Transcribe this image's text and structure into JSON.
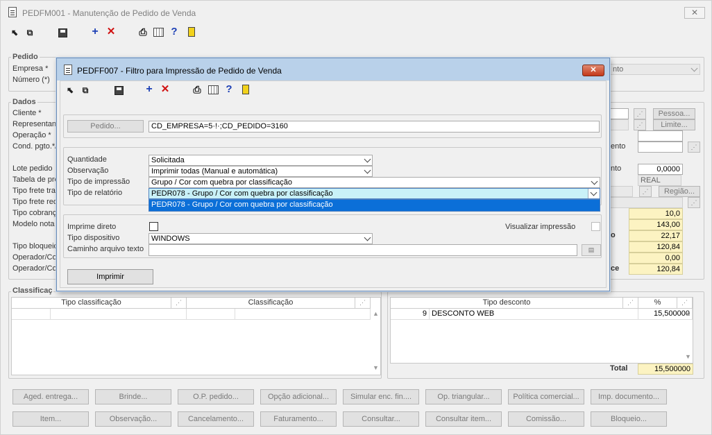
{
  "main": {
    "title": "PEDFM001 - Manutenção de Pedido de Venda",
    "close_glyph": "✕",
    "toolbar": [
      "cursor-icon",
      "copy-icon",
      "save-icon",
      "add-icon",
      "delete-icon",
      "print-icon",
      "calculator-icon",
      "help-icon",
      "exit-icon"
    ],
    "pedido_group": {
      "title": "Pedido",
      "empresa_label": "Empresa *",
      "numero_label": "Número (*)",
      "partial_combo_value": "nto"
    },
    "dados_group": {
      "title": "Dados",
      "labels": [
        "Cliente *",
        "Representan",
        "Operação *",
        "Cond. pgto.*/",
        "Lote pedido",
        "Tabela de pre",
        "Tipo frete tra",
        "Tipo frete red",
        "Tipo cobranç",
        "Modelo nota",
        "Tipo bloqueio",
        "Operador/Co",
        "Operador/Co"
      ],
      "pessoa_button": "Pessoa...",
      "limite_button": "Limite...",
      "regiao_button": "Região...",
      "right_label_1": "ento",
      "right_label_2": "nto",
      "right_label_3": "o",
      "right_label_4": "ce",
      "value_0000": "0,0000",
      "real_value": "REAL",
      "values": [
        "10,0",
        "143,00",
        "22,17",
        "120,84",
        "0,00",
        "120,84"
      ]
    },
    "classificacao": {
      "title": "Classificaç",
      "columns": [
        "Tipo classificação",
        "Classificação"
      ]
    },
    "desconto": {
      "columns": [
        "Tipo desconto",
        "%"
      ],
      "rows": [
        {
          "code": "9",
          "desc": "DESCONTO WEB",
          "pct": "15,500000"
        }
      ],
      "total_label": "Total",
      "total_value": "15,500000"
    },
    "buttons_row1": [
      "Aged. entrega...",
      "Brinde...",
      "O.P. pedido...",
      "Opção adicional...",
      "Simular enc. fin....",
      "Op. triangular...",
      "Política comercial...",
      "Imp. documento..."
    ],
    "buttons_row2": [
      "Item...",
      "Observação...",
      "Cancelamento...",
      "Faturamento...",
      "Consultar...",
      "Consultar item...",
      "Comissão...",
      "Bloqueio..."
    ]
  },
  "dialog": {
    "title": "PEDFF007 - Filtro para Impressão de Pedido de Venda",
    "close_glyph": "✕",
    "pedido_button": "Pedido...",
    "pedido_value": "CD_EMPRESA=5·!·;CD_PEDIDO=3160",
    "quantidade_label": "Quantidade",
    "quantidade_value": "Solicitada",
    "observacao_label": "Observação",
    "observacao_value": "Imprimir todas (Manual e automática)",
    "tipo_impressao_label": "Tipo de impressão",
    "tipo_impressao_value": "Grupo / Cor com quebra por classificação",
    "tipo_relatorio_label": "Tipo de relatório",
    "tipo_relatorio_value": "PEDR078 - Grupo / Cor com quebra por classificação",
    "dropdown_options": [
      "PEDR078 - Grupo / Cor com quebra por classificação"
    ],
    "imprime_direto_label": "Imprime direto",
    "visualizar_label": "Visualizar impressão",
    "tipo_dispositivo_label": "Tipo dispositivo",
    "tipo_dispositivo_value": "WINDOWS",
    "caminho_label": "Caminho arquivo texto",
    "imprimir_button": "Imprimir"
  }
}
